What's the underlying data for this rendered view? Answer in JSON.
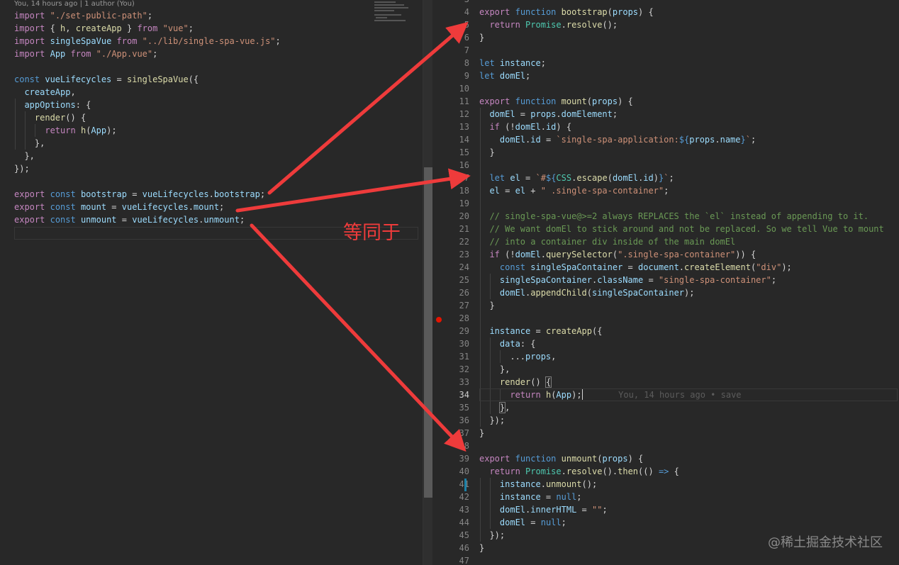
{
  "left_editor": {
    "blame_header": "You, 14 hours ago | 1 author (You)",
    "lines": [
      [
        [
          "k",
          "import"
        ],
        [
          "p",
          " "
        ],
        [
          "s",
          "\"./set-public-path\""
        ],
        [
          "p",
          ";"
        ]
      ],
      [
        [
          "k",
          "import"
        ],
        [
          "p",
          " { "
        ],
        [
          "f",
          "h"
        ],
        [
          "p",
          ", "
        ],
        [
          "f",
          "createApp"
        ],
        [
          "p",
          " } "
        ],
        [
          "k",
          "from"
        ],
        [
          "p",
          " "
        ],
        [
          "s",
          "\"vue\""
        ],
        [
          "p",
          ";"
        ]
      ],
      [
        [
          "k",
          "import"
        ],
        [
          "p",
          " "
        ],
        [
          "v",
          "singleSpaVue"
        ],
        [
          "p",
          " "
        ],
        [
          "k",
          "from"
        ],
        [
          "p",
          " "
        ],
        [
          "s",
          "\"../lib/single-spa-vue.js\""
        ],
        [
          "p",
          ";"
        ]
      ],
      [
        [
          "k",
          "import"
        ],
        [
          "p",
          " "
        ],
        [
          "v",
          "App"
        ],
        [
          "p",
          " "
        ],
        [
          "k",
          "from"
        ],
        [
          "p",
          " "
        ],
        [
          "s",
          "\"./App.vue\""
        ],
        [
          "p",
          ";"
        ]
      ],
      [],
      [
        [
          "kb",
          "const"
        ],
        [
          "p",
          " "
        ],
        [
          "v",
          "vueLifecycles"
        ],
        [
          "p",
          " = "
        ],
        [
          "f",
          "singleSpaVue"
        ],
        [
          "p",
          "({"
        ]
      ],
      [
        [
          "p",
          "  "
        ],
        [
          "v",
          "createApp"
        ],
        [
          "p",
          ","
        ]
      ],
      [
        [
          "p",
          "  "
        ],
        [
          "v",
          "appOptions"
        ],
        [
          "p",
          ": {"
        ]
      ],
      [
        [
          "p",
          "    "
        ],
        [
          "f",
          "render"
        ],
        [
          "p",
          "() {"
        ]
      ],
      [
        [
          "p",
          "      "
        ],
        [
          "k",
          "return"
        ],
        [
          "p",
          " "
        ],
        [
          "f",
          "h"
        ],
        [
          "p",
          "("
        ],
        [
          "v",
          "App"
        ],
        [
          "p",
          ");"
        ]
      ],
      [
        [
          "p",
          "    },"
        ]
      ],
      [
        [
          "p",
          "  },"
        ]
      ],
      [
        [
          "p",
          "});"
        ]
      ],
      [],
      [
        [
          "k",
          "export"
        ],
        [
          "p",
          " "
        ],
        [
          "kb",
          "const"
        ],
        [
          "p",
          " "
        ],
        [
          "v",
          "bootstrap"
        ],
        [
          "p",
          " = "
        ],
        [
          "v",
          "vueLifecycles"
        ],
        [
          "p",
          "."
        ],
        [
          "v",
          "bootstrap"
        ],
        [
          "p",
          ";"
        ]
      ],
      [
        [
          "k",
          "export"
        ],
        [
          "p",
          " "
        ],
        [
          "kb",
          "const"
        ],
        [
          "p",
          " "
        ],
        [
          "v",
          "mount"
        ],
        [
          "p",
          " = "
        ],
        [
          "v",
          "vueLifecycles"
        ],
        [
          "p",
          "."
        ],
        [
          "v",
          "mount"
        ],
        [
          "p",
          ";"
        ]
      ],
      [
        [
          "k",
          "export"
        ],
        [
          "p",
          " "
        ],
        [
          "kb",
          "const"
        ],
        [
          "p",
          " "
        ],
        [
          "v",
          "unmount"
        ],
        [
          "p",
          " = "
        ],
        [
          "v",
          "vueLifecycles"
        ],
        [
          "p",
          "."
        ],
        [
          "v",
          "unmount"
        ],
        [
          "p",
          ";"
        ]
      ]
    ]
  },
  "right_editor": {
    "line_numbers": [
      "3",
      "4",
      "5",
      "6",
      "7",
      "8",
      "9",
      "10",
      "11",
      "12",
      "13",
      "14",
      "15",
      "16",
      "17",
      "18",
      "19",
      "20",
      "21",
      "22",
      "23",
      "24",
      "25",
      "26",
      "27",
      "28",
      "29",
      "30",
      "31",
      "32",
      "33",
      "34",
      "35",
      "36",
      "37",
      "38",
      "39",
      "40",
      "41",
      "42",
      "43",
      "44",
      "45",
      "46",
      "47"
    ],
    "active_line_number": "34",
    "breakpoint_line": "28",
    "modified_line": "41",
    "inline_blame": "You, 14 hours ago • save",
    "lines": [
      [],
      [
        [
          "k",
          "export"
        ],
        [
          "p",
          " "
        ],
        [
          "kb",
          "function"
        ],
        [
          "p",
          " "
        ],
        [
          "f",
          "bootstrap"
        ],
        [
          "p",
          "("
        ],
        [
          "v",
          "props"
        ],
        [
          "p",
          ") {"
        ]
      ],
      [
        [
          "p",
          "  "
        ],
        [
          "k",
          "return"
        ],
        [
          "p",
          " "
        ],
        [
          "t",
          "Promise"
        ],
        [
          "p",
          "."
        ],
        [
          "f",
          "resolve"
        ],
        [
          "p",
          "();"
        ]
      ],
      [
        [
          "p",
          "}"
        ]
      ],
      [],
      [
        [
          "kb",
          "let"
        ],
        [
          "p",
          " "
        ],
        [
          "v",
          "instance"
        ],
        [
          "p",
          ";"
        ]
      ],
      [
        [
          "kb",
          "let"
        ],
        [
          "p",
          " "
        ],
        [
          "v",
          "domEl"
        ],
        [
          "p",
          ";"
        ]
      ],
      [],
      [
        [
          "k",
          "export"
        ],
        [
          "p",
          " "
        ],
        [
          "kb",
          "function"
        ],
        [
          "p",
          " "
        ],
        [
          "f",
          "mount"
        ],
        [
          "p",
          "("
        ],
        [
          "v",
          "props"
        ],
        [
          "p",
          ") {"
        ]
      ],
      [
        [
          "p",
          "  "
        ],
        [
          "v",
          "domEl"
        ],
        [
          "p",
          " = "
        ],
        [
          "v",
          "props"
        ],
        [
          "p",
          "."
        ],
        [
          "v",
          "domElement"
        ],
        [
          "p",
          ";"
        ]
      ],
      [
        [
          "p",
          "  "
        ],
        [
          "k",
          "if"
        ],
        [
          "p",
          " (!"
        ],
        [
          "v",
          "domEl"
        ],
        [
          "p",
          "."
        ],
        [
          "v",
          "id"
        ],
        [
          "p",
          ") {"
        ]
      ],
      [
        [
          "p",
          "    "
        ],
        [
          "v",
          "domEl"
        ],
        [
          "p",
          "."
        ],
        [
          "v",
          "id"
        ],
        [
          "p",
          " = "
        ],
        [
          "s",
          "`single-spa-application:"
        ],
        [
          "kb",
          "${"
        ],
        [
          "v",
          "props"
        ],
        [
          "p",
          "."
        ],
        [
          "v",
          "name"
        ],
        [
          "kb",
          "}"
        ],
        [
          "s",
          "`"
        ],
        [
          "p",
          ";"
        ]
      ],
      [
        [
          "p",
          "  }"
        ]
      ],
      [],
      [
        [
          "p",
          "  "
        ],
        [
          "kb",
          "let"
        ],
        [
          "p",
          " "
        ],
        [
          "v",
          "el"
        ],
        [
          "p",
          " = "
        ],
        [
          "s",
          "`#"
        ],
        [
          "kb",
          "${"
        ],
        [
          "t",
          "CSS"
        ],
        [
          "p",
          "."
        ],
        [
          "f",
          "escape"
        ],
        [
          "p",
          "("
        ],
        [
          "v",
          "domEl"
        ],
        [
          "p",
          "."
        ],
        [
          "v",
          "id"
        ],
        [
          "p",
          ")"
        ],
        [
          "kb",
          "}"
        ],
        [
          "s",
          "`"
        ],
        [
          "p",
          ";"
        ]
      ],
      [
        [
          "p",
          "  "
        ],
        [
          "v",
          "el"
        ],
        [
          "p",
          " = "
        ],
        [
          "v",
          "el"
        ],
        [
          "p",
          " + "
        ],
        [
          "s",
          "\" .single-spa-container\""
        ],
        [
          "p",
          ";"
        ]
      ],
      [],
      [
        [
          "p",
          "  "
        ],
        [
          "c",
          "// single-spa-vue@>=2 always REPLACES the `el` instead of appending to it."
        ]
      ],
      [
        [
          "p",
          "  "
        ],
        [
          "c",
          "// We want domEl to stick around and not be replaced. So we tell Vue to mount"
        ]
      ],
      [
        [
          "p",
          "  "
        ],
        [
          "c",
          "// into a container div inside of the main domEl"
        ]
      ],
      [
        [
          "p",
          "  "
        ],
        [
          "k",
          "if"
        ],
        [
          "p",
          " (!"
        ],
        [
          "v",
          "domEl"
        ],
        [
          "p",
          "."
        ],
        [
          "f",
          "querySelector"
        ],
        [
          "p",
          "("
        ],
        [
          "s",
          "\".single-spa-container\""
        ],
        [
          "p",
          ")) {"
        ]
      ],
      [
        [
          "p",
          "    "
        ],
        [
          "kb",
          "const"
        ],
        [
          "p",
          " "
        ],
        [
          "v",
          "singleSpaContainer"
        ],
        [
          "p",
          " = "
        ],
        [
          "v",
          "document"
        ],
        [
          "p",
          "."
        ],
        [
          "f",
          "createElement"
        ],
        [
          "p",
          "("
        ],
        [
          "s",
          "\"div\""
        ],
        [
          "p",
          ");"
        ]
      ],
      [
        [
          "p",
          "    "
        ],
        [
          "v",
          "singleSpaContainer"
        ],
        [
          "p",
          "."
        ],
        [
          "v",
          "className"
        ],
        [
          "p",
          " = "
        ],
        [
          "s",
          "\"single-spa-container\""
        ],
        [
          "p",
          ";"
        ]
      ],
      [
        [
          "p",
          "    "
        ],
        [
          "v",
          "domEl"
        ],
        [
          "p",
          "."
        ],
        [
          "f",
          "appendChild"
        ],
        [
          "p",
          "("
        ],
        [
          "v",
          "singleSpaContainer"
        ],
        [
          "p",
          ");"
        ]
      ],
      [
        [
          "p",
          "  }"
        ]
      ],
      [],
      [
        [
          "p",
          "  "
        ],
        [
          "v",
          "instance"
        ],
        [
          "p",
          " = "
        ],
        [
          "f",
          "createApp"
        ],
        [
          "p",
          "({"
        ]
      ],
      [
        [
          "p",
          "    "
        ],
        [
          "v",
          "data"
        ],
        [
          "p",
          ": {"
        ]
      ],
      [
        [
          "p",
          "      ..."
        ],
        [
          "v",
          "props"
        ],
        [
          "p",
          ","
        ]
      ],
      [
        [
          "p",
          "    },"
        ]
      ],
      [
        [
          "p",
          "    "
        ],
        [
          "f",
          "render"
        ],
        [
          "p",
          "() "
        ],
        [
          "box",
          "{"
        ]
      ],
      [
        [
          "p",
          "      "
        ],
        [
          "k",
          "return"
        ],
        [
          "p",
          " "
        ],
        [
          "f",
          "h"
        ],
        [
          "p",
          "("
        ],
        [
          "v",
          "App"
        ],
        [
          "p",
          ");"
        ],
        [
          "caret",
          ""
        ],
        [
          "p",
          "       "
        ],
        [
          "blame",
          "You, 14 hours ago • save"
        ]
      ],
      [
        [
          "p",
          "    "
        ],
        [
          "box",
          "}"
        ],
        [
          "p",
          ","
        ]
      ],
      [
        [
          "p",
          "  });"
        ]
      ],
      [
        [
          "p",
          "}"
        ]
      ],
      [],
      [
        [
          "k",
          "export"
        ],
        [
          "p",
          " "
        ],
        [
          "kb",
          "function"
        ],
        [
          "p",
          " "
        ],
        [
          "f",
          "unmount"
        ],
        [
          "p",
          "("
        ],
        [
          "v",
          "props"
        ],
        [
          "p",
          ") {"
        ]
      ],
      [
        [
          "p",
          "  "
        ],
        [
          "k",
          "return"
        ],
        [
          "p",
          " "
        ],
        [
          "t",
          "Promise"
        ],
        [
          "p",
          "."
        ],
        [
          "f",
          "resolve"
        ],
        [
          "p",
          "()."
        ],
        [
          "f",
          "then"
        ],
        [
          "p",
          "(() "
        ],
        [
          "kb",
          "=>"
        ],
        [
          "p",
          " {"
        ]
      ],
      [
        [
          "p",
          "    "
        ],
        [
          "v",
          "instance"
        ],
        [
          "p",
          "."
        ],
        [
          "f",
          "unmount"
        ],
        [
          "p",
          "();"
        ]
      ],
      [
        [
          "p",
          "    "
        ],
        [
          "v",
          "instance"
        ],
        [
          "p",
          " = "
        ],
        [
          "kb",
          "null"
        ],
        [
          "p",
          ";"
        ]
      ],
      [
        [
          "p",
          "    "
        ],
        [
          "v",
          "domEl"
        ],
        [
          "p",
          "."
        ],
        [
          "v",
          "innerHTML"
        ],
        [
          "p",
          " = "
        ],
        [
          "s",
          "\"\""
        ],
        [
          "p",
          ";"
        ]
      ],
      [
        [
          "p",
          "    "
        ],
        [
          "v",
          "domEl"
        ],
        [
          "p",
          " = "
        ],
        [
          "kb",
          "null"
        ],
        [
          "p",
          ";"
        ]
      ],
      [
        [
          "p",
          "  });"
        ]
      ],
      [
        [
          "p",
          "}"
        ]
      ],
      []
    ]
  },
  "annotation": {
    "label": "等同于",
    "color": "#ee3b3b"
  },
  "watermark": "@稀土掘金技术社区",
  "colors": {
    "background": "#282828",
    "keyword_control": "#c586c0",
    "keyword": "#569cd6",
    "function": "#dcdcaa",
    "variable": "#9cdcfe",
    "string": "#ce9178",
    "type": "#4ec9b0",
    "comment": "#6a9955",
    "breakpoint": "#e51400",
    "arrow": "#ee3b3b"
  }
}
